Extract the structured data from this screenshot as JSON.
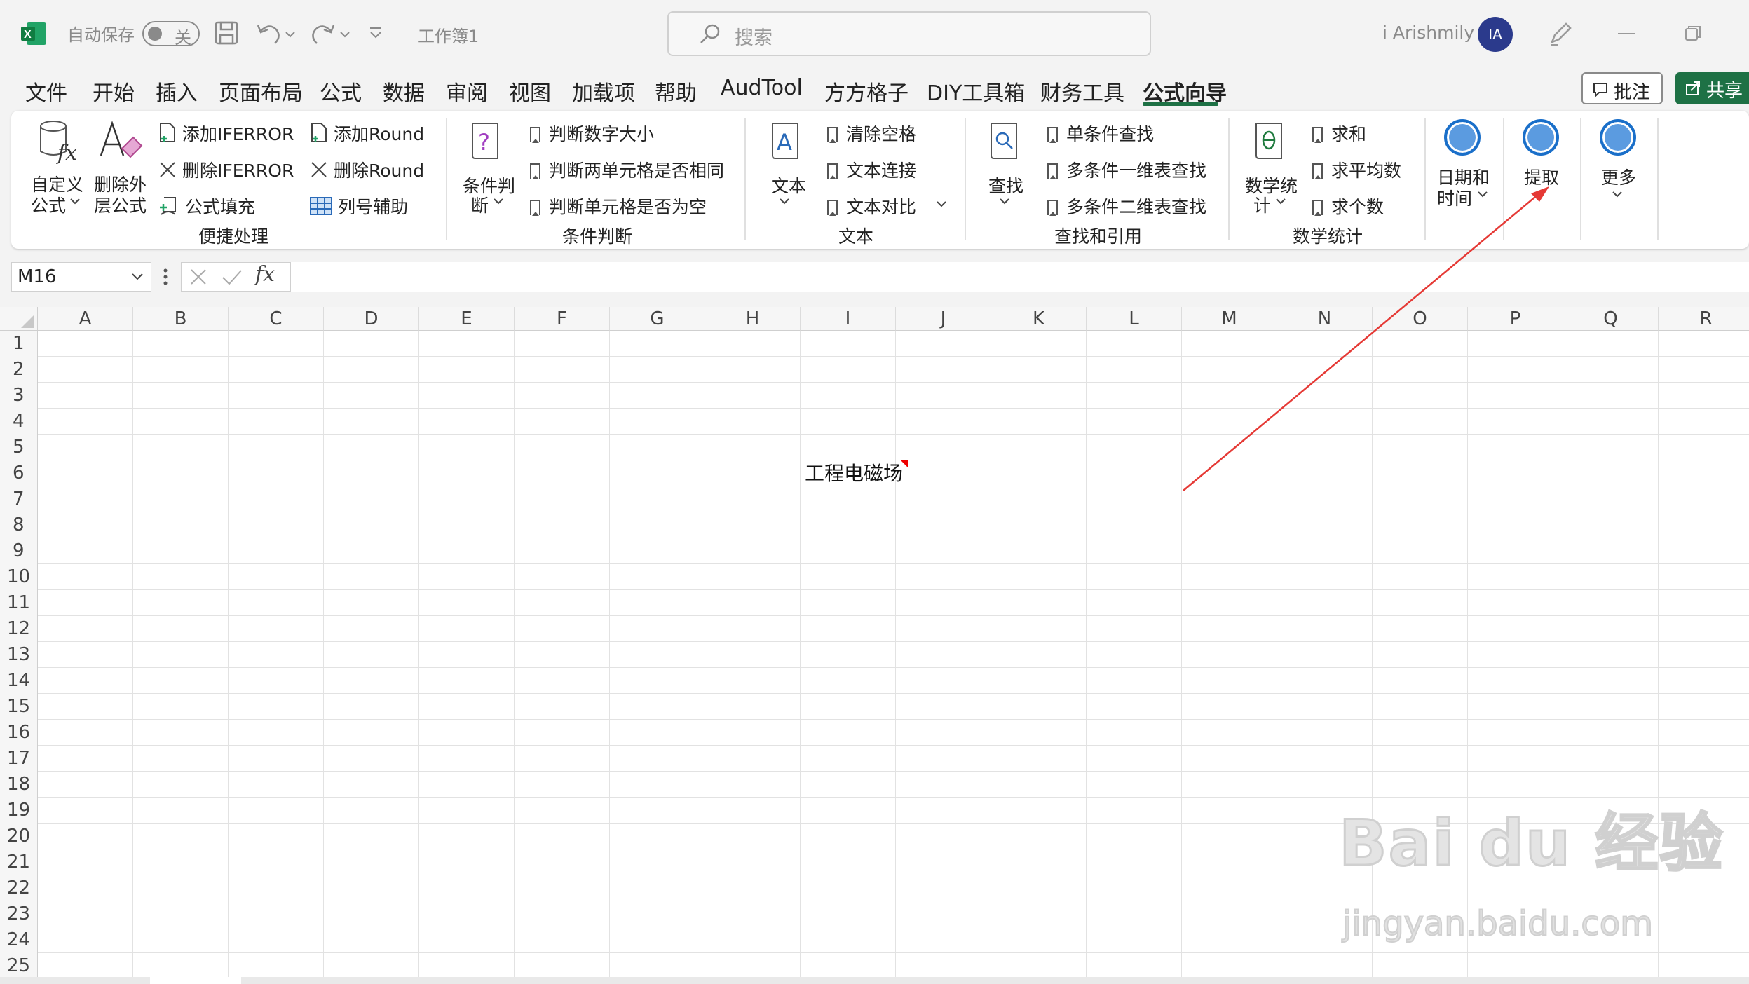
{
  "titlebar": {
    "autosave_label": "自动保存",
    "autosave_state": "关",
    "filename": "工作簿1",
    "search_placeholder": "搜索",
    "user_name": "i Arishmily",
    "avatar_initials": "IA"
  },
  "menu": {
    "tabs": [
      "文件",
      "开始",
      "插入",
      "页面布局",
      "公式",
      "数据",
      "审阅",
      "视图",
      "加载项",
      "帮助",
      "AudTool",
      "方方格子",
      "DIY工具箱",
      "财务工具",
      "公式向导"
    ],
    "active_tab": "公式向导",
    "comment_label": "批注",
    "share_label": "共享"
  },
  "ribbon": {
    "quick": {
      "custom_formula": [
        "自定义",
        "公式"
      ],
      "remove_outer": [
        "删除外",
        "层公式"
      ],
      "add_iferror": "添加IFERROR",
      "remove_iferror": "删除IFERROR",
      "formula_fill": "公式填充",
      "add_round": "添加Round",
      "remove_round": "删除Round",
      "col_helper": "列号辅助",
      "group": "便捷处理"
    },
    "condition": {
      "big": [
        "条件判",
        "断"
      ],
      "items": [
        "判断数字大小",
        "判断两单元格是否相同",
        "判断单元格是否为空"
      ],
      "group": "条件判断"
    },
    "text": {
      "big": "文本",
      "items": [
        "清除空格",
        "文本连接",
        "文本对比"
      ],
      "group": "文本"
    },
    "lookup": {
      "big": "查找",
      "items": [
        "单条件查找",
        "多条件一维表查找",
        "多条件二维表查找"
      ],
      "group": "查找和引用"
    },
    "math": {
      "big": [
        "数学统",
        "计"
      ],
      "items": [
        "求和",
        "求平均数",
        "求个数"
      ],
      "group": "数学统计"
    },
    "datetime": [
      "日期和",
      "时间"
    ],
    "extract": "提取",
    "more": "更多"
  },
  "formula_bar": {
    "name_box": "M16",
    "fx": "fx",
    "content": ""
  },
  "sheet": {
    "columns": [
      "A",
      "B",
      "C",
      "D",
      "E",
      "F",
      "G",
      "H",
      "I",
      "J",
      "K",
      "L",
      "M",
      "N",
      "O",
      "P",
      "Q",
      "R"
    ],
    "rows": [
      "1",
      "2",
      "3",
      "4",
      "5",
      "6",
      "7",
      "8",
      "9",
      "10",
      "11",
      "12",
      "13",
      "14",
      "15",
      "16",
      "17",
      "18",
      "19",
      "20",
      "21",
      "22",
      "23",
      "24",
      "25"
    ],
    "cell_I6": "工程电磁场"
  },
  "watermark": {
    "main": "Bai du 经验",
    "url": "jingyan.baidu.com"
  },
  "colors": {
    "excel_green": "#1e7145",
    "avatar_blue": "#2b3a8c",
    "annotation_arrow": "#e53935",
    "ribbon_circle": "#1a6fc9"
  }
}
